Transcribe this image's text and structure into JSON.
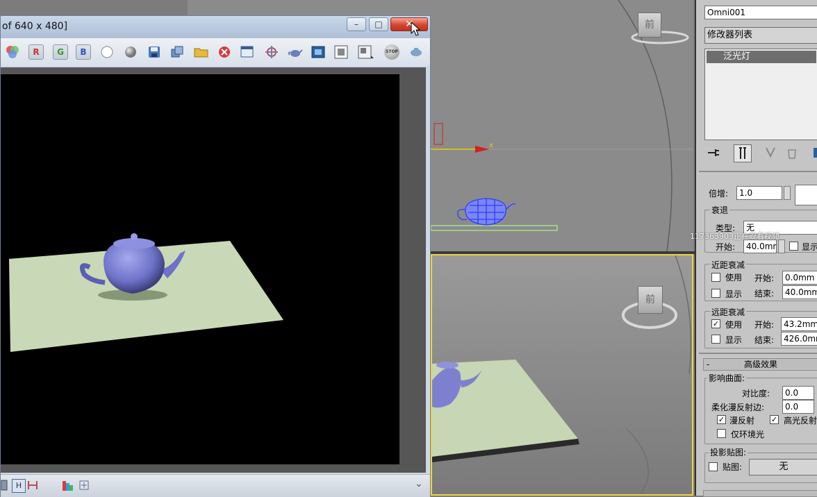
{
  "render_window": {
    "title": "of 640 x 480]",
    "buttons": {
      "minimize": "–",
      "maximize": "□",
      "close": "✕"
    },
    "channels": {
      "red": "R",
      "green": "G",
      "blue": "B"
    },
    "toolbar_icons": [
      "rgb-channels-icon",
      "red-channel-icon",
      "green-channel-icon",
      "blue-channel-icon",
      "white-circle-icon",
      "gray-sphere-icon",
      "save-icon",
      "clone-icon",
      "open-folder-icon",
      "clear-icon",
      "window-icon",
      "crosshair-icon",
      "teapot-render-icon",
      "region-icon",
      "frame-icon",
      "render-setup-icon",
      "stop-icon",
      "teapot-small-icon"
    ],
    "stop_label": "STOP",
    "status_icons": [
      "grid-icon",
      "h-icon",
      "split-h-icon",
      "color-bars-icon",
      "zoom-icon",
      "expand-chevron-icon"
    ],
    "status_h_label": "H",
    "expand_label": "⌄"
  },
  "viewports": {
    "top_cube_label": "前",
    "perspective_cube_label": "前",
    "axis_x_label": "x",
    "active_border_color": "#f2d43a"
  },
  "command_panel": {
    "object_name": "Omni001",
    "modifier_list": "修改器列表",
    "stack_items": [
      "泛光灯"
    ],
    "multiplier_label": "倍增:",
    "multiplier_value": "1.0",
    "decay": {
      "title": "衰退",
      "type_label": "类型:",
      "type_value": "无",
      "start_label": "开始:",
      "start_value": "40.0mr",
      "show_label": "显示"
    },
    "near_atten": {
      "title": "近距衰减",
      "use_label": "使用",
      "use_checked": false,
      "start_label": "开始:",
      "start_value": "0.0mm",
      "show_label": "显示",
      "show_checked": false,
      "end_label": "结束:",
      "end_value": "40.0mm"
    },
    "far_atten": {
      "title": "远距衰减",
      "use_label": "使用",
      "use_checked": true,
      "start_label": "开始:",
      "start_value": "43.2mm",
      "show_label": "显示",
      "show_checked": false,
      "end_label": "结束:",
      "end_value": "426.0mr"
    },
    "advanced": {
      "rollout_sign": "-",
      "rollout_title": "高级效果",
      "affect_title": "影响曲面:",
      "contrast_label": "对比度:",
      "contrast_value": "0.0",
      "soften_label": "柔化漫反射边:",
      "soften_value": "0.0",
      "diffuse_label": "漫反射",
      "diffuse_checked": true,
      "specular_label": "高光反射",
      "specular_checked": true,
      "ambient_label": "仅环境光",
      "ambient_checked": false
    },
    "projector": {
      "title": "投影贴图:",
      "map_label": "贴图:",
      "map_checked": false,
      "map_button": "无"
    }
  },
  "watermark": "117363903正在观看视频",
  "check_mark": "✓"
}
